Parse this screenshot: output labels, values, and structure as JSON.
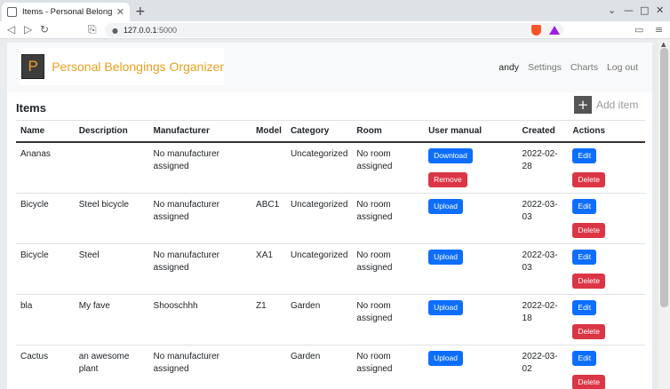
{
  "browser": {
    "tab_title": "Items - Personal Belongings Organizer",
    "new_tab_symbol": "+",
    "url_host": "127.0.0.1",
    "url_port": ":5000"
  },
  "navbar": {
    "brand_initial": "P",
    "brand_name": "Personal Belongings Organizer",
    "user": "andy",
    "settings": "Settings",
    "charts": "Charts",
    "logout": "Log out"
  },
  "page": {
    "heading": "Items",
    "add_item": "Add item"
  },
  "table": {
    "columns": [
      "Name",
      "Description",
      "Manufacturer",
      "Model",
      "Category",
      "Room",
      "User manual",
      "Created",
      "Actions"
    ],
    "rows": [
      {
        "name": "Ananas",
        "description": "",
        "manufacturer": "No manufacturer assigned",
        "model": "",
        "category": "Uncategorized",
        "room": "No room assigned",
        "manual_primary": "Download",
        "manual_secondary": "Remove",
        "created": "2022-02-\n28",
        "edit": "Edit",
        "delete": "Delete"
      },
      {
        "name": "Bicycle",
        "description": "Steel bicycle",
        "manufacturer": "No manufacturer assigned",
        "model": "ABC1",
        "category": "Uncategorized",
        "room": "No room assigned",
        "manual_primary": "Upload",
        "manual_secondary": null,
        "created": "2022-03-\n03",
        "edit": "Edit",
        "delete": "Delete"
      },
      {
        "name": "Bicycle",
        "description": "Steel",
        "manufacturer": "No manufacturer assigned",
        "model": "XA1",
        "category": "Uncategorized",
        "room": "No room assigned",
        "manual_primary": "Upload",
        "manual_secondary": null,
        "created": "2022-03-\n03",
        "edit": "Edit",
        "delete": "Delete"
      },
      {
        "name": "bla",
        "description": "My fave",
        "manufacturer": "Shooschhh",
        "model": "Z1",
        "category": "Garden",
        "room": "No room assigned",
        "manual_primary": "Upload",
        "manual_secondary": null,
        "created": "2022-02-\n18",
        "edit": "Edit",
        "delete": "Delete"
      },
      {
        "name": "Cactus",
        "description": "an awesome plant",
        "manufacturer": "No manufacturer assigned",
        "model": "",
        "category": "Garden",
        "room": "No room assigned",
        "manual_primary": "Upload",
        "manual_secondary": null,
        "created": "2022-03-\n02",
        "edit": "Edit",
        "delete": "Delete"
      }
    ]
  },
  "colors": {
    "primary": "#0d6efd",
    "danger": "#dc3545",
    "brand": "#e8a020"
  }
}
